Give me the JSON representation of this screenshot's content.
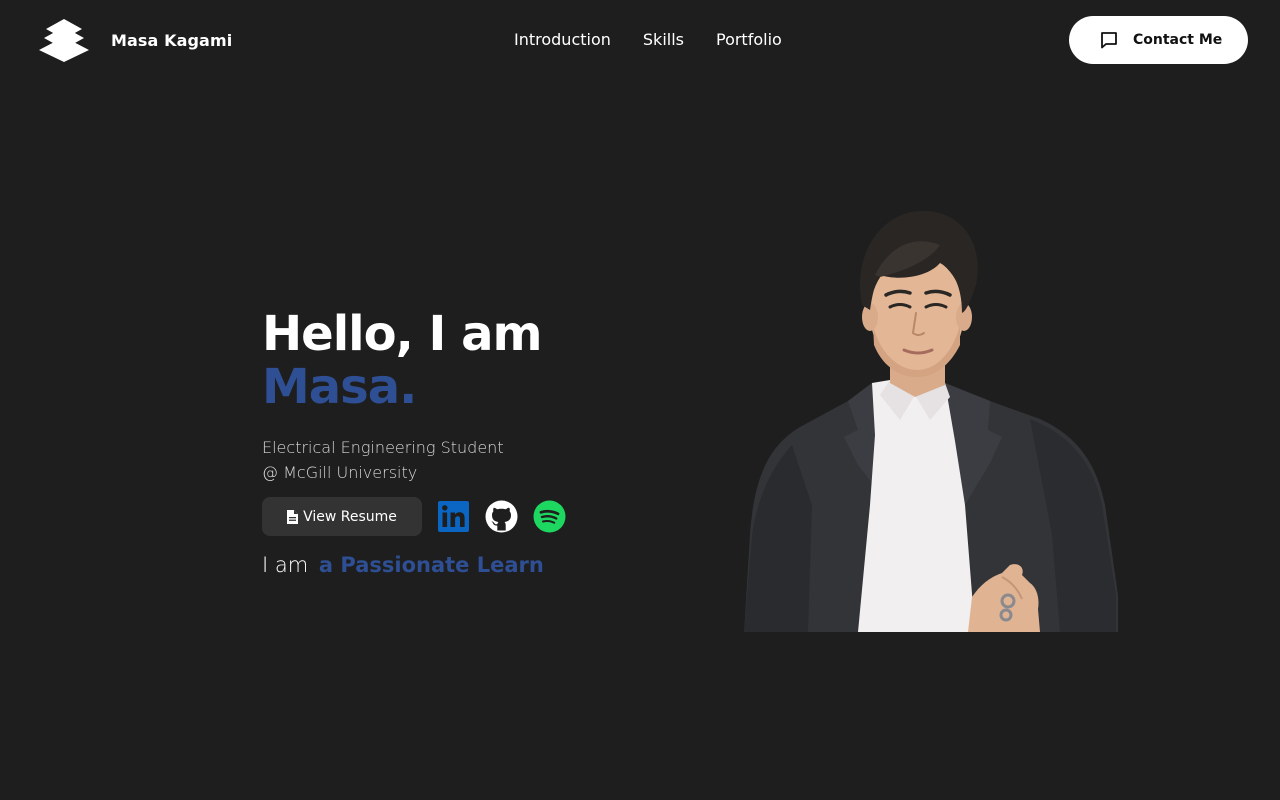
{
  "header": {
    "brand_name": "Masa Kagami",
    "nav": [
      {
        "label": "Introduction"
      },
      {
        "label": "Skills"
      },
      {
        "label": "Portfolio"
      }
    ],
    "contact_label": "Contact Me",
    "contact_icon": "chat-bubble-icon",
    "logo_icon": "stacked-layers-logo"
  },
  "hero": {
    "title_line1": "Hello, I am",
    "title_line2": "Masa.",
    "subtitle_line1": "Electrical Engineering Student",
    "subtitle_line2": "@ McGill University",
    "resume_label": "View Resume",
    "resume_icon": "file-icon",
    "social_links": [
      {
        "name": "linkedin-icon",
        "color": "#0a66c2"
      },
      {
        "name": "github-icon",
        "color": "#ffffff"
      },
      {
        "name": "spotify-icon",
        "color": "#1ed760"
      }
    ],
    "typed_prefix": "I am",
    "typed_role": "a Passionate Learn"
  },
  "colors": {
    "background": "#1e1e1e",
    "accent": "#2e4f93",
    "button_dark": "#333333",
    "button_light": "#ffffff"
  }
}
